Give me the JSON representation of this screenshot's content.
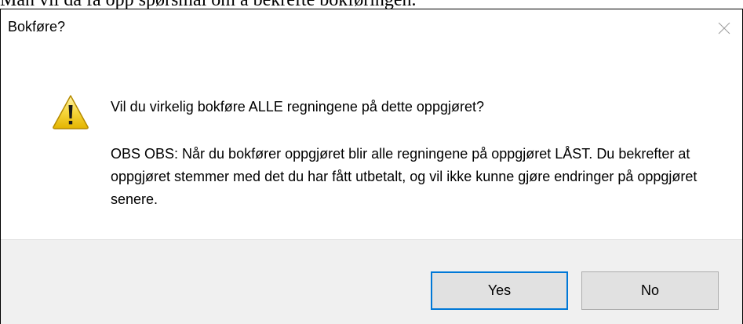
{
  "document": {
    "caption": "Man vil da få opp spørsmål om å bekrefte bokføringen."
  },
  "dialog": {
    "title": "Bokføre?",
    "close_icon": "close-icon",
    "warning_icon": "warning-icon",
    "question": "Vil du virkelig bokføre ALLE regningene på dette oppgjøret?",
    "note": "OBS OBS: Når du bokfører oppgjøret blir alle regningene på oppgjøret LÅST. Du bekrefter at oppgjøret stemmer med det du har fått utbetalt, og vil ikke kunne gjøre endringer på oppgjøret senere.",
    "buttons": {
      "yes": "Yes",
      "no": "No"
    }
  },
  "colors": {
    "focus_border": "#0078d7",
    "footer_bg": "#f0f0f0",
    "button_bg": "#e1e1e1",
    "warning_yellow": "#f7d63c"
  }
}
